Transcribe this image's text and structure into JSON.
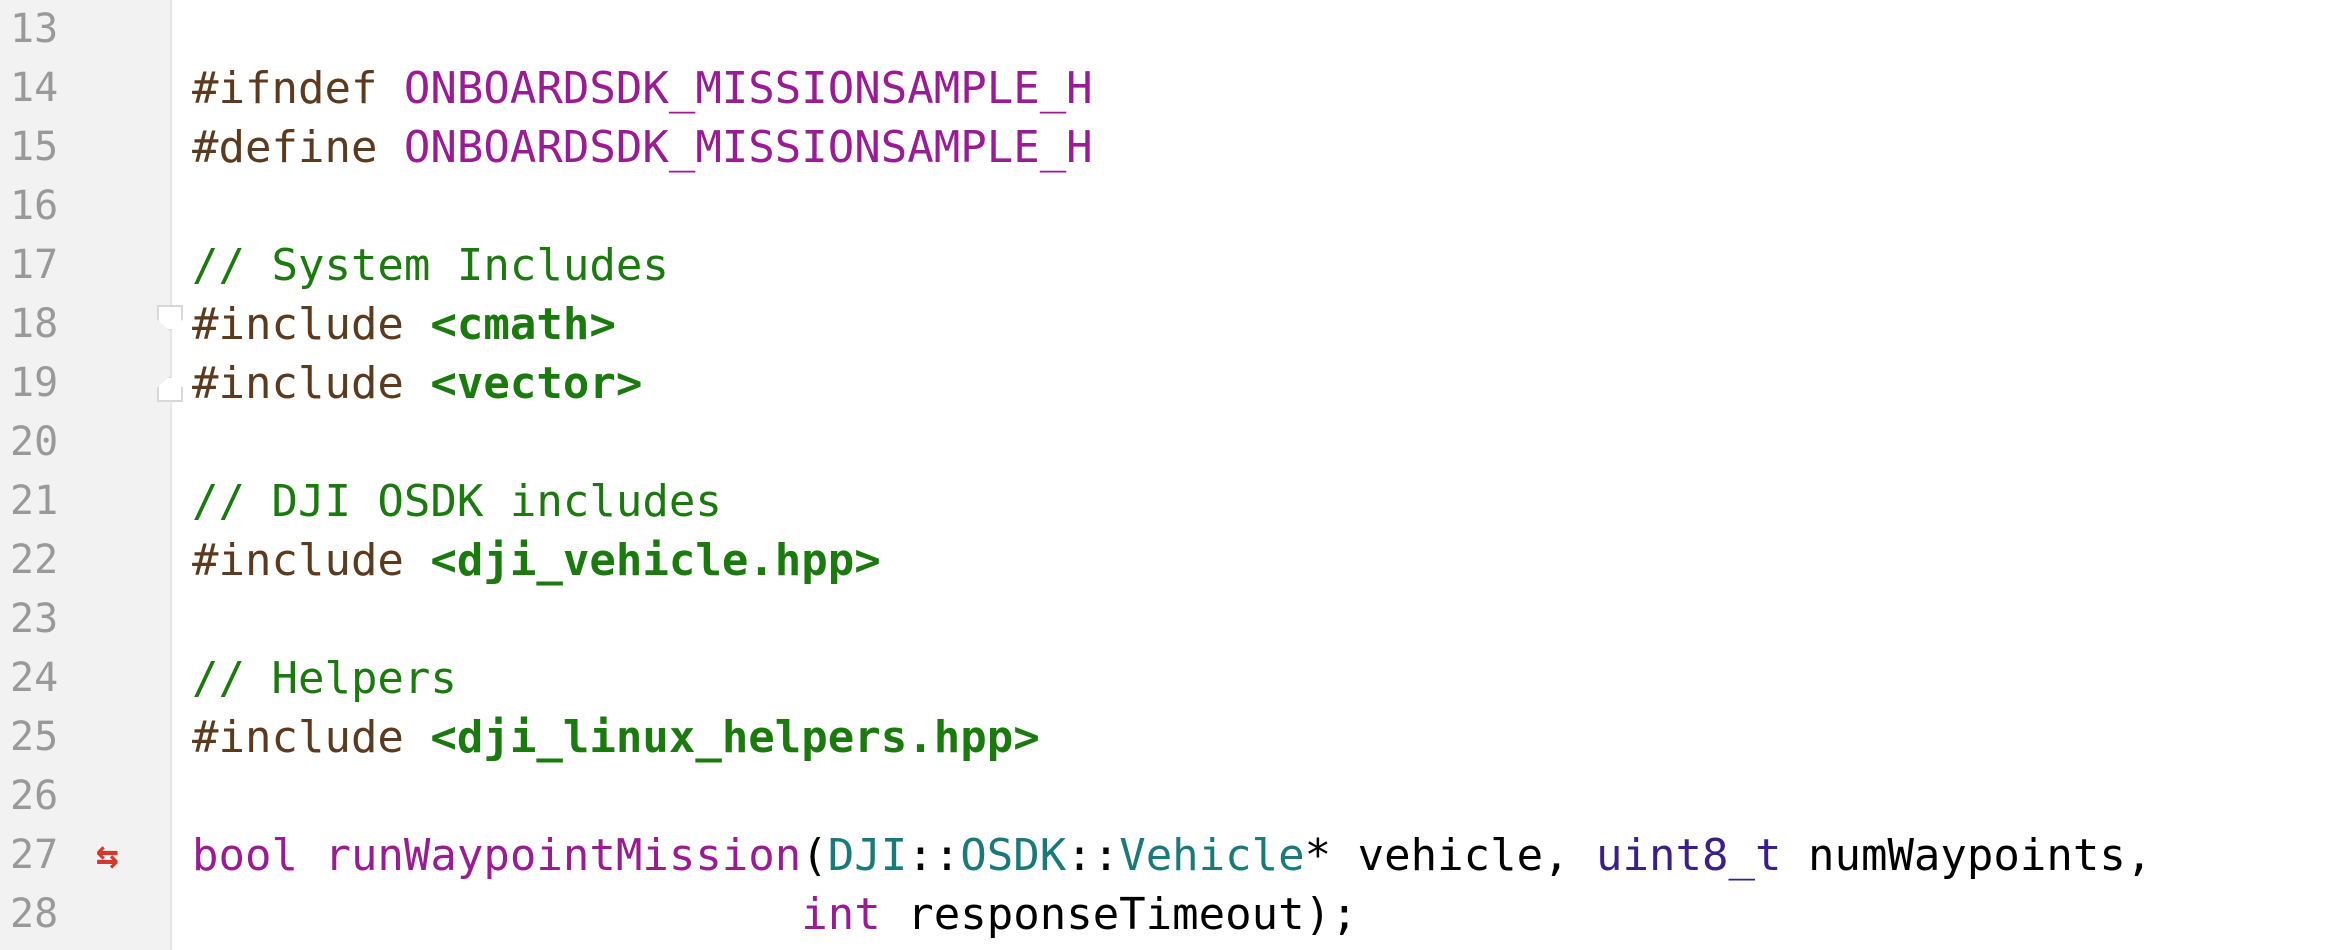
{
  "editor": {
    "lines": [
      {
        "num": "13",
        "tokens": []
      },
      {
        "num": "14",
        "tokens": [
          {
            "text": "#ifndef ",
            "kind": "directive"
          },
          {
            "text": "ONBOARDSDK_MISSIONSAMPLE_H",
            "kind": "macro"
          }
        ]
      },
      {
        "num": "15",
        "tokens": [
          {
            "text": "#define ",
            "kind": "directive"
          },
          {
            "text": "ONBOARDSDK_MISSIONSAMPLE_H",
            "kind": "macro"
          }
        ]
      },
      {
        "num": "16",
        "tokens": []
      },
      {
        "num": "17",
        "tokens": [
          {
            "text": "// System Includes",
            "kind": "comment"
          }
        ]
      },
      {
        "num": "18",
        "fold": "top",
        "tokens": [
          {
            "text": "#include ",
            "kind": "directive"
          },
          {
            "text": "<cmath>",
            "kind": "header"
          }
        ]
      },
      {
        "num": "19",
        "fold": "bottom",
        "tokens": [
          {
            "text": "#include ",
            "kind": "directive"
          },
          {
            "text": "<vector>",
            "kind": "header"
          }
        ]
      },
      {
        "num": "20",
        "tokens": []
      },
      {
        "num": "21",
        "tokens": [
          {
            "text": "// DJI OSDK includes",
            "kind": "comment"
          }
        ]
      },
      {
        "num": "22",
        "tokens": [
          {
            "text": "#include ",
            "kind": "directive"
          },
          {
            "text": "<dji_vehicle.hpp>",
            "kind": "header"
          }
        ]
      },
      {
        "num": "23",
        "tokens": []
      },
      {
        "num": "24",
        "tokens": [
          {
            "text": "// Helpers",
            "kind": "comment"
          }
        ]
      },
      {
        "num": "25",
        "tokens": [
          {
            "text": "#include ",
            "kind": "directive"
          },
          {
            "text": "<dji_linux_helpers.hpp>",
            "kind": "header"
          }
        ]
      },
      {
        "num": "26",
        "tokens": []
      },
      {
        "num": "27",
        "marker": "⇆",
        "tokens": [
          {
            "text": "bool ",
            "kind": "keyword"
          },
          {
            "text": "runWaypointMission",
            "kind": "func"
          },
          {
            "text": "(",
            "kind": "plain"
          },
          {
            "text": "DJI",
            "kind": "ns"
          },
          {
            "text": "::",
            "kind": "plain"
          },
          {
            "text": "OSDK",
            "kind": "ns"
          },
          {
            "text": "::",
            "kind": "plain"
          },
          {
            "text": "Vehicle",
            "kind": "ns"
          },
          {
            "text": "* vehicle, ",
            "kind": "plain"
          },
          {
            "text": "uint8_t",
            "kind": "type"
          },
          {
            "text": " numWaypoints,",
            "kind": "plain"
          }
        ]
      },
      {
        "num": "28",
        "tokens": [
          {
            "text": "                       ",
            "kind": "plain"
          },
          {
            "text": "int",
            "kind": "keyword"
          },
          {
            "text": " responseTimeout);",
            "kind": "plain"
          }
        ]
      }
    ]
  }
}
